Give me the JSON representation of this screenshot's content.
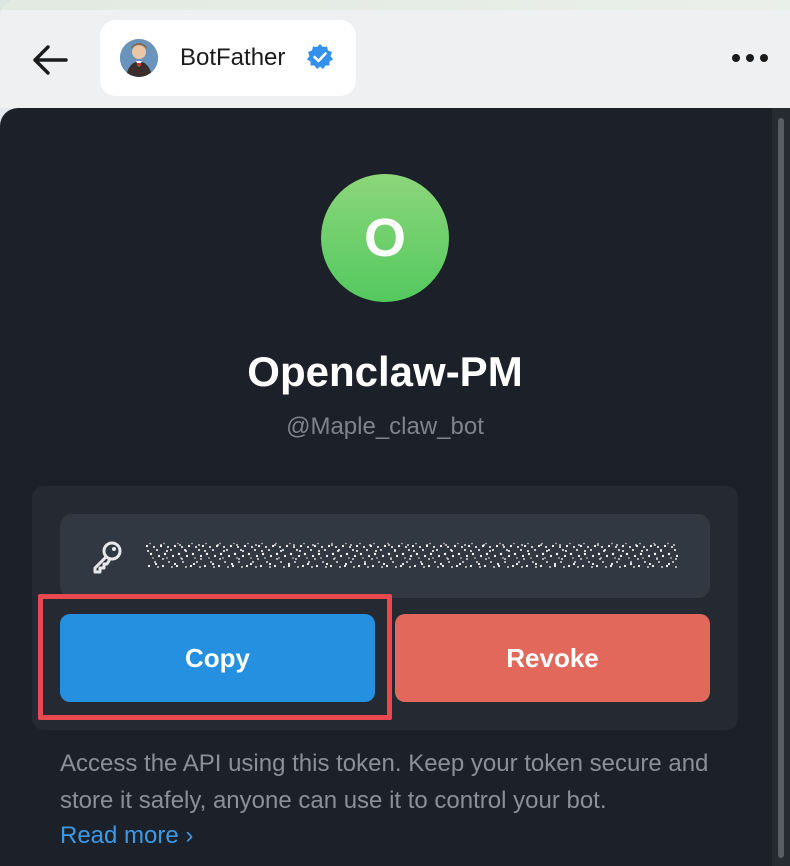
{
  "header": {
    "chat_name": "BotFather",
    "verified_icon": "verified-badge-icon",
    "back_icon": "arrow-left-icon",
    "more_icon": "more-horizontal-icon"
  },
  "bot": {
    "avatar_letter": "O",
    "name": "Openclaw-PM",
    "username": "@Maple_claw_bot"
  },
  "token": {
    "icon": "key-icon",
    "masked": true
  },
  "buttons": {
    "copy_label": "Copy",
    "revoke_label": "Revoke"
  },
  "info": {
    "text": "Access the API using this token. Keep your token secure and store it safely, anyone can use it to control your bot.",
    "link_label": "Read more ›"
  },
  "colors": {
    "copy": "#2590e0",
    "revoke": "#e2685c",
    "avatar_green": "#53c95e",
    "highlight": "#ea4a4f"
  }
}
